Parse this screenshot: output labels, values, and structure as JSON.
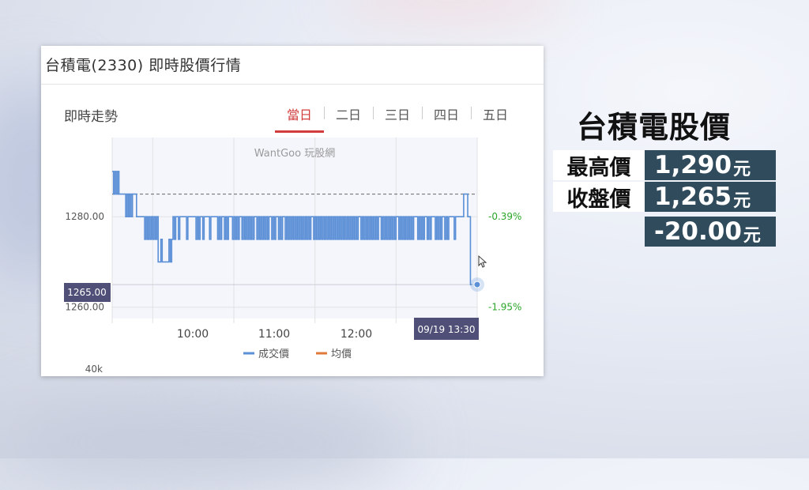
{
  "card": {
    "title": "台積電(2330) 即時股價行情",
    "section_label": "即時走勢",
    "tabs": [
      "當日",
      "二日",
      "三日",
      "四日",
      "五日"
    ],
    "active_tab": 0
  },
  "chart_data": {
    "type": "line",
    "watermark": "WantGoo 玩股網",
    "x_ticks": [
      "10:00",
      "11:00",
      "12:00"
    ],
    "y_ticks_left": [
      "1280.00",
      "1260.00"
    ],
    "y_ticks_right": [
      "-0.39%",
      "-1.95%"
    ],
    "ylim": [
      1257.5,
      1297.5
    ],
    "reference_price": 1285,
    "current_price_label": "1265.00",
    "current_time_label": "09/19 13:30",
    "volume_axis_label": "40k",
    "legend": [
      {
        "name": "成交價",
        "color": "#5b8fd6"
      },
      {
        "name": "均價",
        "color": "#e07a3a"
      }
    ],
    "series": [
      {
        "name": "成交價",
        "color": "#5b8fd6",
        "x_minutes": [
          0,
          1,
          2,
          3,
          4,
          5,
          6,
          7,
          8,
          9,
          10,
          11,
          12,
          13,
          14,
          15,
          16,
          17,
          18,
          19,
          20,
          21,
          22,
          23,
          24,
          25,
          26,
          27,
          28,
          29,
          30,
          31,
          32,
          33,
          34,
          35,
          36,
          37,
          38,
          39,
          40,
          41,
          42,
          43,
          44,
          45,
          46,
          47,
          48,
          49,
          50,
          51,
          52,
          53,
          54,
          55,
          56,
          57,
          58,
          59,
          60,
          61,
          62,
          63,
          64,
          65,
          66,
          67,
          68,
          69,
          70,
          71,
          72,
          73,
          74,
          75,
          76,
          77,
          78,
          79,
          80,
          81,
          82,
          83,
          84,
          85,
          86,
          87,
          88,
          89,
          90,
          91,
          92,
          93,
          94,
          95,
          96,
          97,
          98,
          99,
          100,
          101,
          102,
          103,
          104,
          105,
          106,
          107,
          108,
          109,
          110,
          111,
          112,
          113,
          114,
          115,
          116,
          117,
          118,
          119,
          120,
          121,
          122,
          123,
          124,
          125,
          126,
          127,
          128,
          129,
          130,
          131,
          132,
          133,
          134,
          135,
          136,
          137,
          138,
          139,
          140,
          141,
          142,
          143,
          144,
          145,
          146,
          147,
          148,
          149,
          150,
          151,
          152,
          153,
          154,
          155,
          156,
          157,
          158,
          159,
          160,
          161,
          162,
          163,
          164,
          165,
          166,
          167,
          168,
          169,
          170,
          171,
          172,
          173,
          174,
          175,
          176,
          177,
          178,
          179,
          180,
          181,
          182,
          183,
          184,
          185,
          186,
          187,
          188,
          189,
          190,
          191,
          192,
          193,
          194,
          195,
          196,
          197,
          198,
          199,
          200,
          201,
          202,
          203,
          204,
          205,
          206,
          207,
          208,
          209,
          210,
          211,
          212,
          213,
          214,
          215,
          216,
          217,
          218,
          219,
          220,
          221,
          222,
          223,
          224,
          225,
          226,
          227,
          228,
          229,
          230,
          231,
          232,
          233,
          234,
          235,
          236,
          237,
          238,
          239,
          240,
          241,
          242,
          243,
          244,
          245,
          246,
          247,
          248,
          249,
          250,
          251,
          252,
          253,
          254,
          255,
          256,
          257,
          258,
          259,
          260,
          261,
          262,
          263,
          264,
          265,
          266,
          267,
          268,
          269,
          270
        ],
        "values": [
          1290,
          1285,
          1290,
          1285,
          1290,
          1285,
          1285,
          1285,
          1285,
          1285,
          1280,
          1285,
          1280,
          1285,
          1280,
          1285,
          1285,
          1285,
          1280,
          1280,
          1280,
          1280,
          1280,
          1280,
          1275,
          1280,
          1275,
          1280,
          1275,
          1280,
          1275,
          1280,
          1275,
          1280,
          1270,
          1270,
          1275,
          1270,
          1270,
          1270,
          1270,
          1270,
          1275,
          1270,
          1275,
          1280,
          1275,
          1280,
          1280,
          1275,
          1280,
          1280,
          1280,
          1280,
          1280,
          1275,
          1280,
          1280,
          1280,
          1280,
          1280,
          1280,
          1275,
          1280,
          1275,
          1280,
          1280,
          1275,
          1280,
          1280,
          1280,
          1280,
          1275,
          1280,
          1280,
          1280,
          1280,
          1280,
          1275,
          1280,
          1275,
          1280,
          1280,
          1275,
          1280,
          1275,
          1280,
          1280,
          1280,
          1275,
          1280,
          1275,
          1280,
          1275,
          1280,
          1280,
          1275,
          1280,
          1275,
          1280,
          1275,
          1280,
          1275,
          1280,
          1275,
          1280,
          1280,
          1275,
          1280,
          1275,
          1280,
          1275,
          1280,
          1275,
          1280,
          1275,
          1280,
          1280,
          1275,
          1280,
          1275,
          1280,
          1280,
          1275,
          1280,
          1275,
          1280,
          1280,
          1275,
          1280,
          1275,
          1280,
          1275,
          1280,
          1275,
          1280,
          1275,
          1280,
          1275,
          1280,
          1275,
          1280,
          1275,
          1280,
          1275,
          1280,
          1275,
          1280,
          1280,
          1275,
          1280,
          1275,
          1280,
          1275,
          1280,
          1275,
          1280,
          1275,
          1280,
          1275,
          1280,
          1275,
          1280,
          1275,
          1280,
          1275,
          1280,
          1275,
          1280,
          1275,
          1280,
          1275,
          1280,
          1275,
          1280,
          1275,
          1280,
          1275,
          1280,
          1275,
          1280,
          1275,
          1280,
          1280,
          1275,
          1280,
          1275,
          1280,
          1275,
          1280,
          1275,
          1280,
          1275,
          1280,
          1275,
          1280,
          1275,
          1280,
          1280,
          1275,
          1280,
          1275,
          1280,
          1275,
          1280,
          1275,
          1280,
          1275,
          1280,
          1275,
          1280,
          1280,
          1275,
          1280,
          1275,
          1280,
          1275,
          1280,
          1275,
          1280,
          1275,
          1280,
          1275,
          1280,
          1280,
          1280,
          1275,
          1280,
          1275,
          1280,
          1275,
          1280,
          1280,
          1275,
          1280,
          1275,
          1280,
          1280,
          1280,
          1275,
          1280,
          1275,
          1280,
          1275,
          1280,
          1280,
          1275,
          1280,
          1275,
          1280,
          1280,
          1280,
          1280,
          1275,
          1280,
          1280,
          1280,
          1280,
          1280,
          1280,
          1285,
          1285,
          1285,
          1280,
          1280,
          1265
        ]
      }
    ]
  },
  "summary": {
    "title": "台積電股價",
    "rows": [
      {
        "label": "最高價",
        "value": "1,290",
        "unit": "元"
      },
      {
        "label": "收盤價",
        "value": "1,265",
        "unit": "元"
      },
      {
        "label": "",
        "value": "-20.00",
        "unit": "元"
      }
    ]
  }
}
